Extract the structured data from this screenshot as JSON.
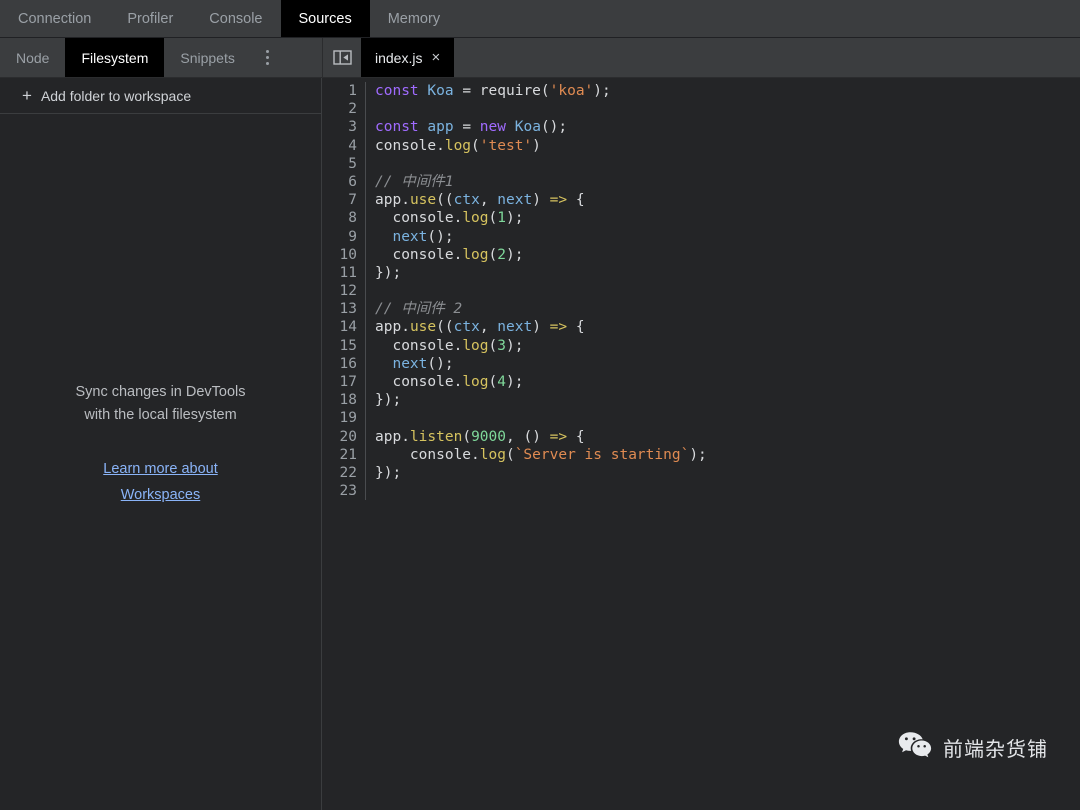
{
  "panel_tabs": [
    {
      "label": "Connection",
      "active": false
    },
    {
      "label": "Profiler",
      "active": false
    },
    {
      "label": "Console",
      "active": false
    },
    {
      "label": "Sources",
      "active": true
    },
    {
      "label": "Memory",
      "active": false
    }
  ],
  "navigator": {
    "tabs": [
      {
        "label": "Node",
        "active": false
      },
      {
        "label": "Filesystem",
        "active": true
      },
      {
        "label": "Snippets",
        "active": false
      }
    ],
    "more_icon": "more-vertical-icon",
    "add_folder_label": "Add folder to workspace",
    "add_folder_icon": "plus-icon",
    "empty_message_line1": "Sync changes in DevTools",
    "empty_message_line2": "with the local filesystem",
    "empty_link_line1": "Learn more about",
    "empty_link_line2": "Workspaces"
  },
  "editor": {
    "collapse_icon": "collapse-navigator-icon",
    "file_tab": {
      "label": "index.js",
      "close_label": "×"
    },
    "line_numbers": [
      "1",
      "2",
      "3",
      "4",
      "5",
      "6",
      "7",
      "8",
      "9",
      "10",
      "11",
      "12",
      "13",
      "14",
      "15",
      "16",
      "17",
      "18",
      "19",
      "20",
      "21",
      "22",
      "23"
    ],
    "code_lines": [
      "const Koa = require('koa');",
      "",
      "const app = new Koa();",
      "console.log('test')",
      "",
      "// 中间件1",
      "app.use((ctx, next) => {",
      "  console.log(1);",
      "  next();",
      "  console.log(2);",
      "});",
      "",
      "// 中间件 2",
      "app.use((ctx, next) => {",
      "  console.log(3);",
      "  next();",
      "  console.log(4);",
      "});",
      "",
      "app.listen(9000, () => {",
      "    console.log(`Server is starting`);",
      "});",
      ""
    ]
  },
  "watermark": {
    "icon": "wechat-icon",
    "text": "前端杂货铺"
  },
  "colors": {
    "panel_background": "#242527",
    "toolbar_background": "#3b3d3f",
    "active_tab_background": "#000000",
    "link": "#8ab4f8",
    "keyword": "#a06bff",
    "definition": "#7bb3e0",
    "string": "#e08b52",
    "number": "#7fd89a",
    "property": "#d6c35f",
    "comment": "#8b8e92"
  }
}
